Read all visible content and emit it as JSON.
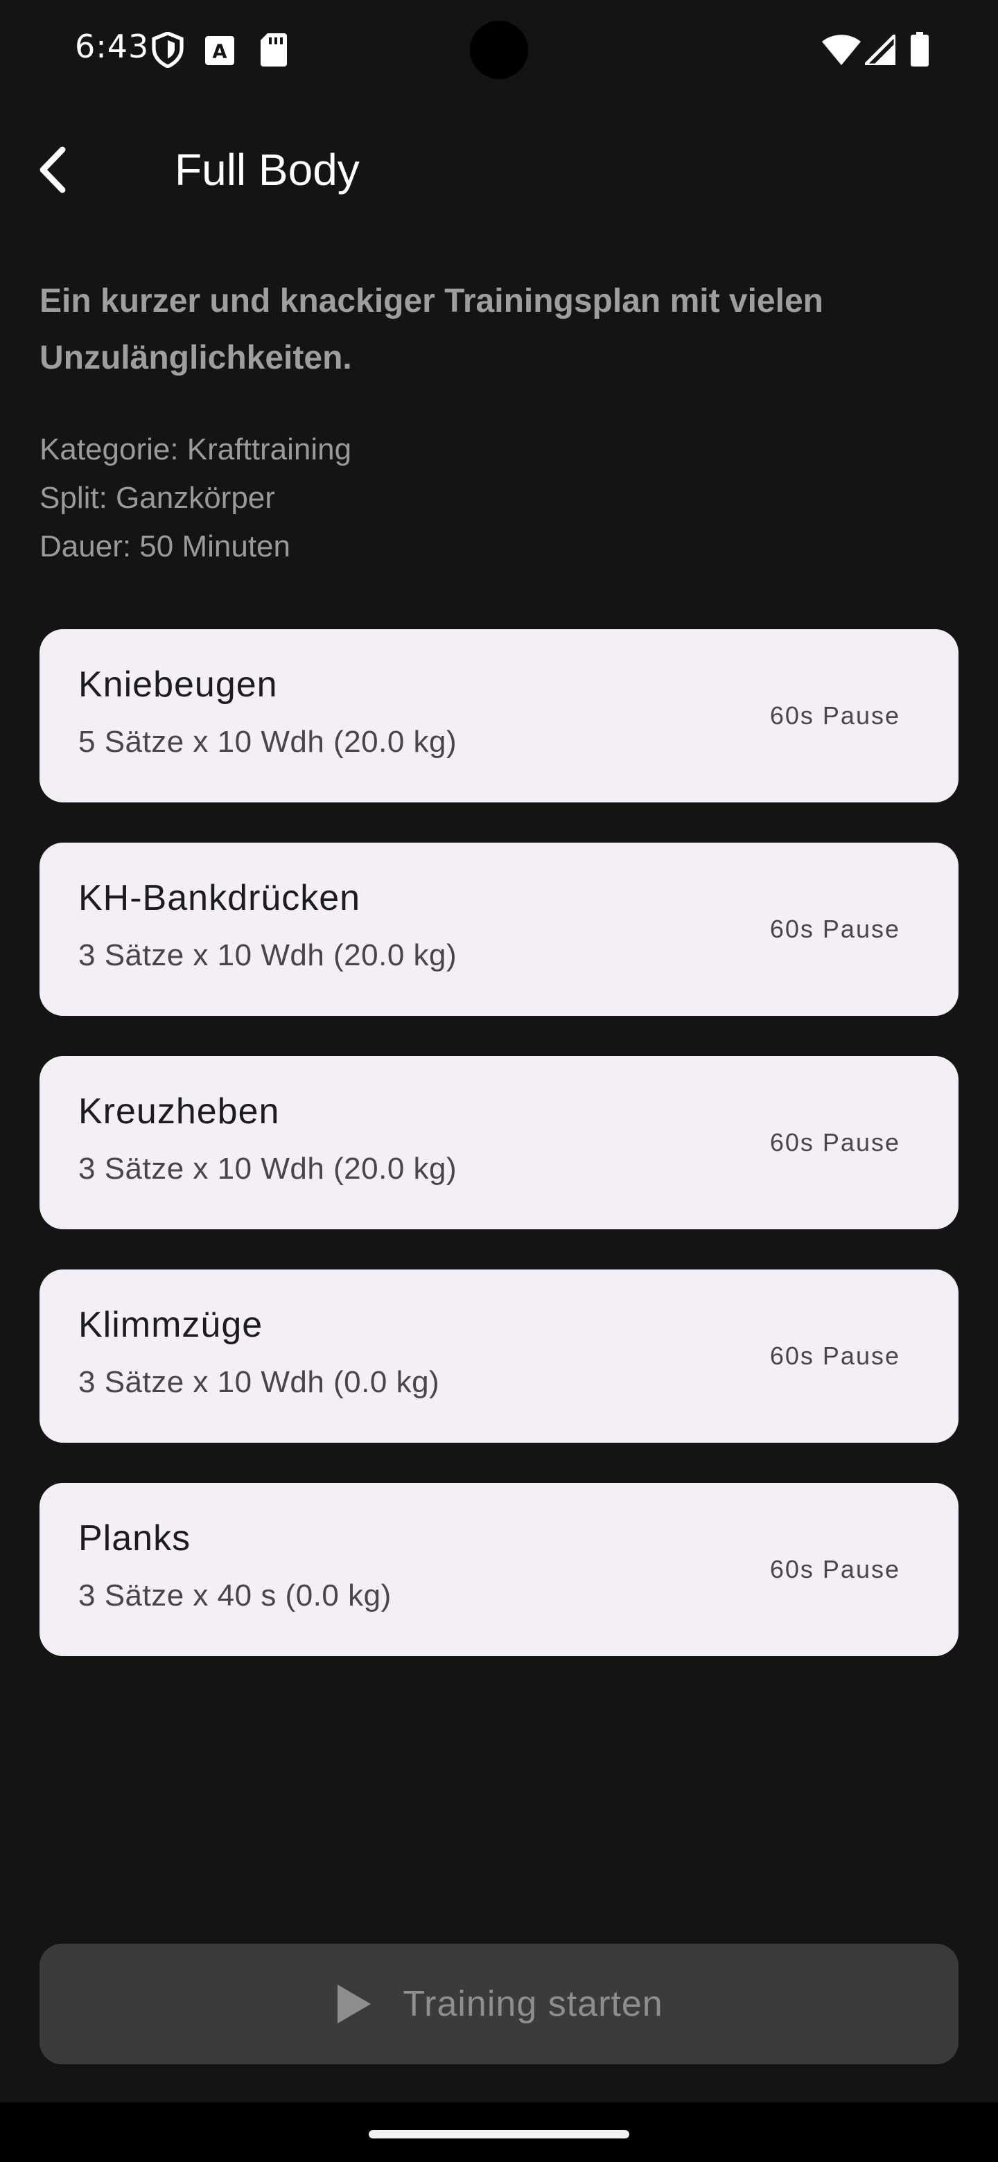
{
  "status_bar": {
    "time": "6:43",
    "left_icons": [
      "shield-icon",
      "text-a-icon",
      "sd-card-icon"
    ],
    "right_icons": [
      "wifi-icon",
      "signal-icon",
      "battery-icon"
    ]
  },
  "app_bar": {
    "back_icon": "chevron-left-icon",
    "title": "Full Body"
  },
  "plan": {
    "description": "Ein kurzer und knackiger Trainingsplan mit vielen Unzulänglichkeiten.",
    "category": "Kategorie: Krafttraining",
    "split": "Split: Ganzkörper",
    "duration": "Dauer: 50 Minuten"
  },
  "exercises": [
    {
      "name": "Kniebeugen",
      "detail": "5 Sätze x 10 Wdh (20.0 kg)",
      "pause": "60s Pause"
    },
    {
      "name": "KH-Bankdrücken",
      "detail": "3 Sätze x 10 Wdh (20.0 kg)",
      "pause": "60s Pause"
    },
    {
      "name": "Kreuzheben",
      "detail": "3 Sätze x 10 Wdh (20.0 kg)",
      "pause": "60s Pause"
    },
    {
      "name": "Klimmzüge",
      "detail": "3 Sätze x 10 Wdh (0.0 kg)",
      "pause": "60s Pause"
    },
    {
      "name": "Planks",
      "detail": "3 Sätze x 40 s (0.0 kg)",
      "pause": "60s Pause"
    }
  ],
  "start_button": {
    "icon": "play-icon",
    "label": "Training starten"
  },
  "colors": {
    "background": "#141414",
    "card": "#f4eff6",
    "button_disabled": "#3b3b3b"
  }
}
